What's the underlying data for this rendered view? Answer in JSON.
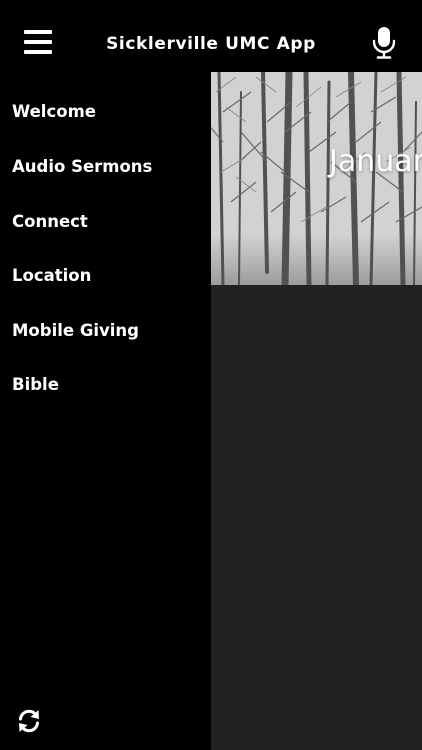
{
  "header": {
    "title": "Sicklerville UMC App",
    "menu_icon": "hamburger-menu-icon",
    "mic_icon": "microphone-icon"
  },
  "drawer": {
    "items": [
      {
        "label": "Welcome"
      },
      {
        "label": "Audio Sermons"
      },
      {
        "label": "Connect"
      },
      {
        "label": "Location"
      },
      {
        "label": "Mobile Giving"
      },
      {
        "label": "Bible"
      }
    ],
    "refresh_icon": "refresh-icon"
  },
  "main": {
    "hero_title": "January"
  },
  "colors": {
    "background": "#000000",
    "text": "#ffffff",
    "content_background": "#222222"
  }
}
